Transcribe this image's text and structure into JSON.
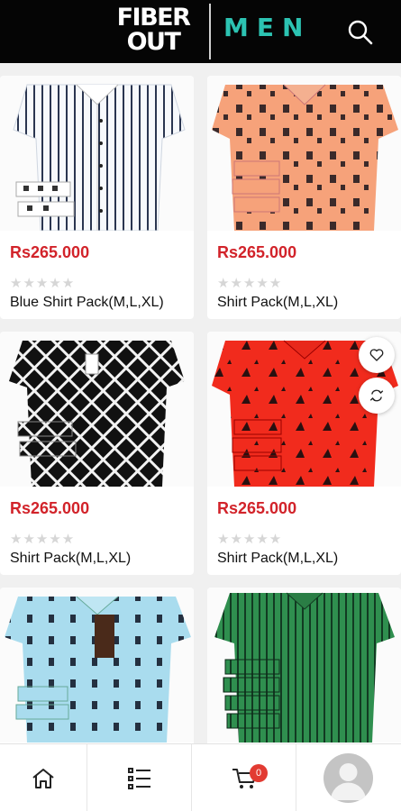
{
  "header": {
    "logo_line1": "FIBER",
    "logo_line2": "OUT",
    "section": "MEN",
    "search_icon": "search-icon"
  },
  "colors": {
    "header_bg": "#050505",
    "accent_teal": "#2cc3b2",
    "price_red": "#d2232a",
    "badge_red": "#e23b32"
  },
  "products": [
    {
      "price": "Rs265.000",
      "name": "Blue Shirt Pack(M,L,XL)",
      "rating": 0
    },
    {
      "price": "Rs265.000",
      "name": "Shirt Pack(M,L,XL)",
      "rating": 0
    },
    {
      "price": "Rs265.000",
      "name": "Shirt Pack(M,L,XL)",
      "rating": 0
    },
    {
      "price": "Rs265.000",
      "name": "Shirt Pack(M,L,XL)",
      "rating": 0
    },
    {
      "price": "",
      "name": "",
      "rating": 0
    },
    {
      "price": "",
      "name": "",
      "rating": 0
    }
  ],
  "card_actions": {
    "wishlist_icon": "heart-icon",
    "compare_icon": "compare-arrows-icon"
  },
  "bottom_nav": {
    "home_icon": "home-icon",
    "categories_icon": "list-icon",
    "cart_icon": "cart-icon",
    "cart_count": "0",
    "profile_icon": "avatar"
  }
}
